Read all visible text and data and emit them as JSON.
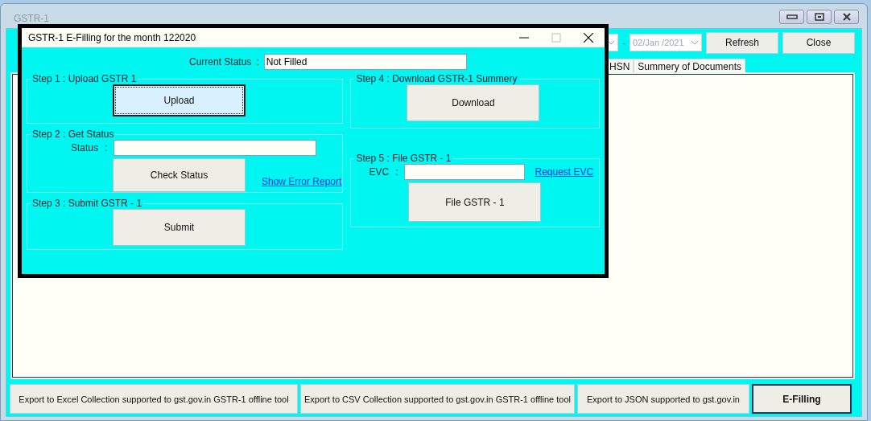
{
  "window": {
    "title": "GSTR-1"
  },
  "toolbar": {
    "separator": "-",
    "date_to": "02/Jan /2021",
    "buttons": [
      "Refresh",
      "Close"
    ]
  },
  "tabs": [
    {
      "label": "HSN",
      "selected": false
    },
    {
      "label": "Summery of Documents",
      "selected": false
    }
  ],
  "footer_buttons": [
    {
      "label": "Export to Excel Collection supported to gst.gov.in GSTR-1 offline tool",
      "focused": false
    },
    {
      "label": "Export to CSV Collection supported to gst.gov.in GSTR-1 offline tool",
      "focused": false
    },
    {
      "label": "Export to JSON supported to gst.gov.in",
      "focused": false
    },
    {
      "label": "E-Filling",
      "focused": true
    }
  ],
  "dialog": {
    "title": "GSTR-1 E-Filling for the month 122020",
    "status_label": "Current Status",
    "status_colon": ":",
    "status_value": "Not Filled",
    "left_steps": [
      {
        "kind": "button",
        "legend": "Step 1 : Upload GSTR 1",
        "button": "Upload",
        "focused": true
      },
      {
        "kind": "status",
        "legend": "Step 2 : Get Status",
        "field_label": "Status",
        "field_colon": ":",
        "button": "Check Status",
        "link": "Show Error Report",
        "focused": false
      },
      {
        "kind": "button",
        "legend": "Step 3 : Submit GSTR - 1",
        "button": "Submit",
        "focused": false
      }
    ],
    "right_steps": [
      {
        "kind": "button",
        "legend": "Step 4 : Download GSTR-1 Summery",
        "button": "Download",
        "focused": false
      },
      {
        "kind": "evc",
        "legend": "Step 5 : File GSTR - 1",
        "field_label": "EVC",
        "field_colon": ":",
        "button": "File GSTR - 1",
        "link": "Request EVC",
        "focused": false
      }
    ]
  }
}
